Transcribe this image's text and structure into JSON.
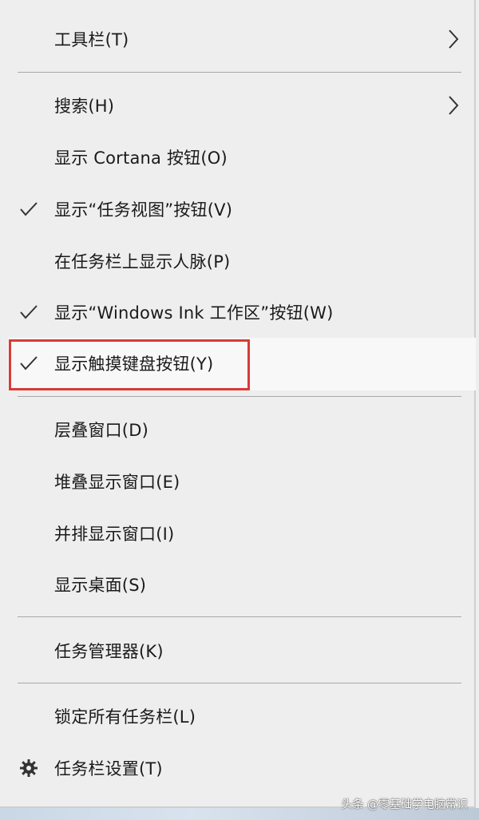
{
  "menu": {
    "items": [
      {
        "label": "工具栏(T)",
        "checked": false,
        "submenu": true
      },
      {
        "label": "搜索(H)",
        "checked": false,
        "submenu": true
      },
      {
        "label": "显示 Cortana 按钮(O)",
        "checked": false
      },
      {
        "label": "显示“任务视图”按钮(V)",
        "checked": true
      },
      {
        "label": "在任务栏上显示人脉(P)",
        "checked": false
      },
      {
        "label": "显示“Windows Ink 工作区”按钮(W)",
        "checked": true
      },
      {
        "label": "显示触摸键盘按钮(Y)",
        "checked": true,
        "highlighted": true
      },
      {
        "label": "层叠窗口(D)"
      },
      {
        "label": "堆叠显示窗口(E)"
      },
      {
        "label": "并排显示窗口(I)"
      },
      {
        "label": "显示桌面(S)"
      },
      {
        "label": "任务管理器(K)"
      },
      {
        "label": "锁定所有任务栏(L)"
      },
      {
        "label": "任务栏设置(T)",
        "icon": "gear-icon"
      }
    ]
  },
  "watermark": "头条 @零基础学电脑常识",
  "colors": {
    "menu_bg": "#eeeeee",
    "highlight_border": "#d93a37",
    "separator": "#a8a8a8"
  }
}
